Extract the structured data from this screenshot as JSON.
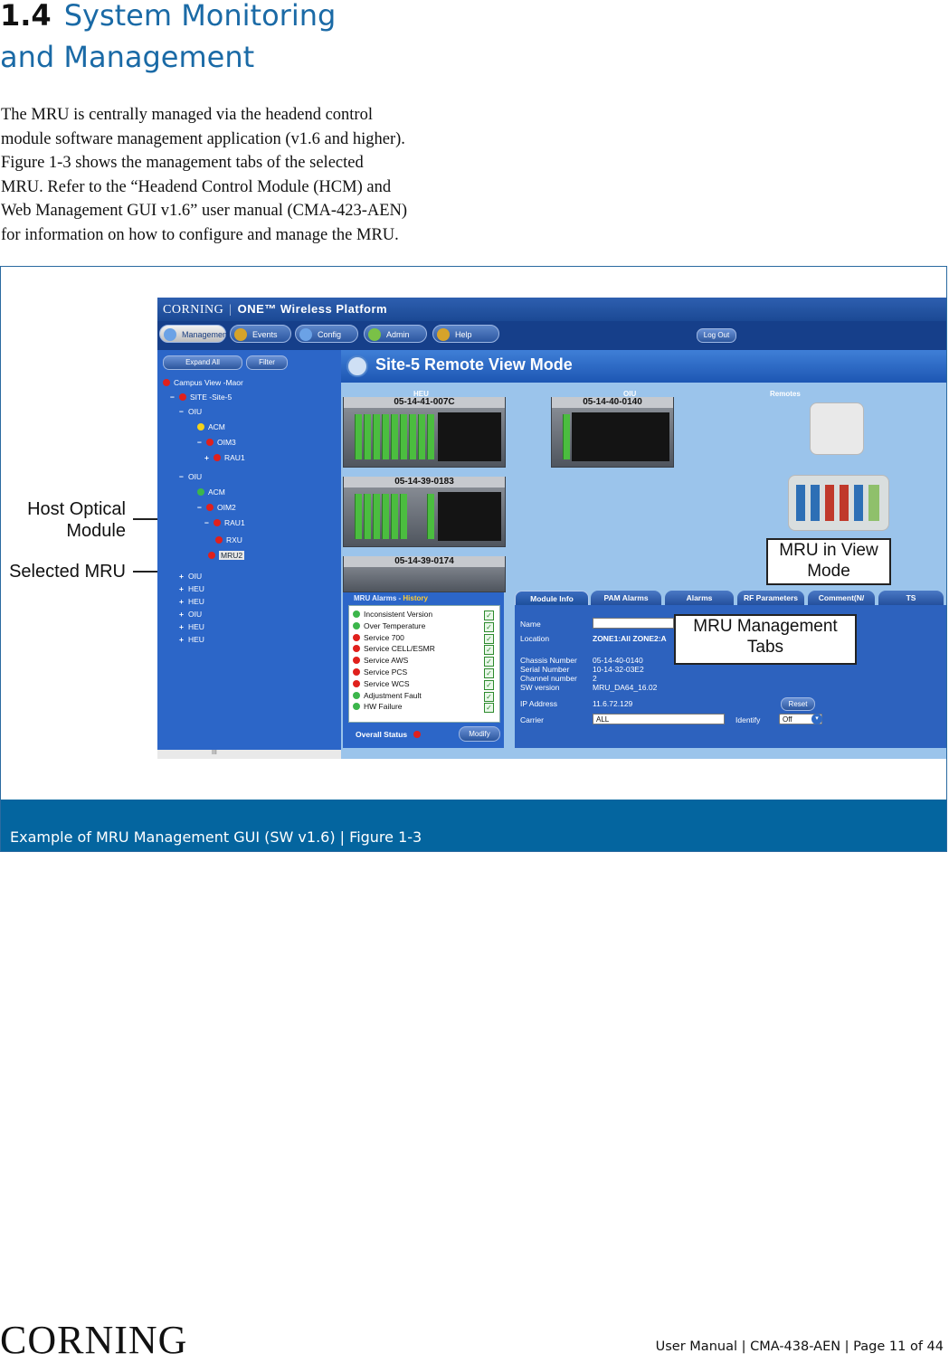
{
  "section": {
    "number": "1.4",
    "title_line1": "System Monitoring",
    "title_line2": "and Management"
  },
  "intro": "The MRU is centrally managed via the headend control\nmodule software management application (v1.6 and higher).\nFigure 1-3 shows the management tabs of the selected\nMRU. Refer to the “Headend Control Module (HCM) and\nWeb Management GUI v1.6” user manual (CMA-423-AEN)\nfor information on how to configure and manage the MRU.",
  "figure": {
    "caption": "Example of MRU Management GUI (SW v1.6) | Figure 1-3",
    "annotations": {
      "host_optical_line1": "Host Optical",
      "host_optical_line2": "Module",
      "selected_mru": "Selected MRU",
      "mru_view_line1": "MRU in View",
      "mru_view_line2": "Mode",
      "mgmt_tabs_line1": "MRU Management",
      "mgmt_tabs_line2": "Tabs"
    },
    "gui": {
      "brand": "CORNING",
      "platform": "ONE™ Wireless Platform",
      "nav_tabs": [
        "Management",
        "Events",
        "Config",
        "Admin",
        "Help"
      ],
      "logout": "Log Out",
      "tree_buttons": [
        "Expand All",
        "Filter"
      ],
      "tree": [
        {
          "label": "Campus View -Maor",
          "pm": "",
          "dot": "red"
        },
        {
          "label": "SITE -Site-5",
          "pm": "−",
          "dot": "red"
        },
        {
          "label": "OIU",
          "pm": "−",
          "dot": ""
        },
        {
          "label": "ACM",
          "pm": "",
          "dot": "yellow"
        },
        {
          "label": "OIM3",
          "pm": "−",
          "dot": "red"
        },
        {
          "label": "RAU1",
          "pm": "+",
          "dot": "red"
        },
        {
          "label": "OIU",
          "pm": "−",
          "dot": ""
        },
        {
          "label": "ACM",
          "pm": "",
          "dot": "green"
        },
        {
          "label": "OIM2",
          "pm": "−",
          "dot": "red"
        },
        {
          "label": "RAU1",
          "pm": "−",
          "dot": "red"
        },
        {
          "label": "RXU",
          "pm": "",
          "dot": "red"
        },
        {
          "label": "MRU2",
          "pm": "",
          "dot": "red"
        },
        {
          "label": "OIU",
          "pm": "+",
          "dot": ""
        },
        {
          "label": "HEU",
          "pm": "+",
          "dot": ""
        },
        {
          "label": "HEU",
          "pm": "+",
          "dot": ""
        },
        {
          "label": "OIU",
          "pm": "+",
          "dot": ""
        },
        {
          "label": "HEU",
          "pm": "+",
          "dot": ""
        },
        {
          "label": "HEU",
          "pm": "+",
          "dot": ""
        }
      ],
      "scroll_label": "III",
      "site_title": "Site-5 Remote View Mode",
      "column_labels": [
        "HEU",
        "OIU",
        "Remotes"
      ],
      "chassis_tags": [
        "05-14-41-007C",
        "05-14-40-0140",
        "05-14-39-0183",
        "05-14-39-0174"
      ],
      "alarms_tab": "MRU Alarms",
      "history_tab": "History",
      "alarms": [
        {
          "label": "Inconsistent Version",
          "dot": "green"
        },
        {
          "label": "Over Temperature",
          "dot": "green"
        },
        {
          "label": "Service 700",
          "dot": "red"
        },
        {
          "label": "Service CELL/ESMR",
          "dot": "red"
        },
        {
          "label": "Service AWS",
          "dot": "red"
        },
        {
          "label": "Service PCS",
          "dot": "red"
        },
        {
          "label": "Service WCS",
          "dot": "red"
        },
        {
          "label": "Adjustment Fault",
          "dot": "green"
        },
        {
          "label": "HW Failure",
          "dot": "green"
        }
      ],
      "overall_status": "Overall Status",
      "modify": "Modify",
      "mgmt_tabs": [
        "Module Info",
        "PAM Alarms",
        "Alarms",
        "RF Parameters",
        "Comment(N/",
        "TS"
      ],
      "module_info": {
        "name_label": "Name",
        "location_label": "Location",
        "location_value": "ZONE1:All ZONE2:A",
        "chassis_label": "Chassis Number",
        "chassis_value": "05-14-40-0140",
        "serial_label": "Serial Number",
        "serial_value": "10-14-32-03E2",
        "channel_label": "Channel number",
        "channel_value": "2",
        "sw_label": "SW version",
        "sw_value": "MRU_DA64_16.02",
        "ip_label": "IP Address",
        "ip_value": "11.6.72.129",
        "carrier_label": "Carrier",
        "carrier_value": "ALL",
        "identify_label": "Identify",
        "identify_value": "Off",
        "reset": "Reset"
      }
    }
  },
  "footer": {
    "logo": "CORNING",
    "text": "User Manual | CMA-438-AEN | Page 11 of 44"
  }
}
